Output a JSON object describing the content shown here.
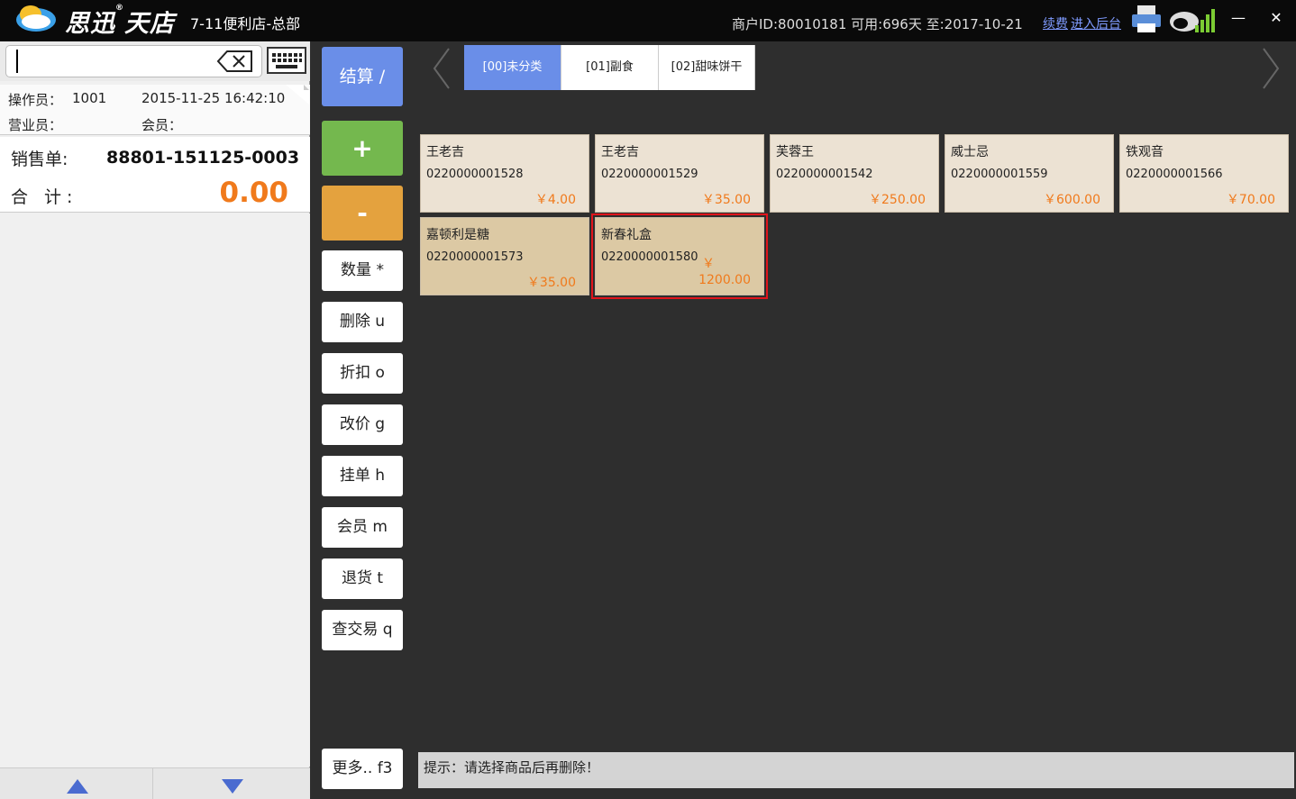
{
  "header": {
    "brand": "思迅",
    "brand_suffix": "天店",
    "registered": "®",
    "store_name": "7-11便利店-总部",
    "merchant_info": "商户ID:80010181 可用:696天 至:2017-10-21",
    "renew_link": "续费",
    "backend_link": "进入后台",
    "minimize": "—",
    "close": "✕"
  },
  "left": {
    "search": {
      "value": "",
      "placeholder": ""
    },
    "operator_label": "操作员：",
    "operator_value": "1001",
    "datetime": "2015-11-25 16:42:10",
    "clerk_label": "营业员：",
    "member_label": "会员：",
    "order_label": "销售单:",
    "order_no": "88801-151125-0003",
    "total_label": "合 计:",
    "total_value": "0.00"
  },
  "buttons": {
    "settle": "结算  /",
    "plus": "+",
    "minus": "-",
    "quantity": "数量 *",
    "delete": "删除 u",
    "discount": "折扣 o",
    "change_price": "改价 g",
    "hold": "挂单 h",
    "member": "会员 m",
    "refund": "退货 t",
    "query": "查交易 q",
    "more": "更多.. f3"
  },
  "tabs": [
    {
      "label": "[00]未分类",
      "active": true
    },
    {
      "label": "[01]副食",
      "active": false
    },
    {
      "label": "[02]甜味饼干",
      "active": false
    }
  ],
  "products": [
    {
      "name": "王老吉",
      "code": "0220000001528",
      "price": "￥4.00"
    },
    {
      "name": "王老吉",
      "code": "0220000001529",
      "price": "￥35.00"
    },
    {
      "name": "芙蓉王",
      "code": "0220000001542",
      "price": "￥250.00"
    },
    {
      "name": "威士忌",
      "code": "0220000001559",
      "price": "￥600.00"
    },
    {
      "name": "铁观音",
      "code": "0220000001566",
      "price": "￥70.00"
    },
    {
      "name": "嘉顿利是糖",
      "code": "0220000001573",
      "price": "￥35.00"
    },
    {
      "name": "新春礼盒",
      "code": "0220000001580",
      "price": "￥",
      "price2": "1200.00"
    }
  ],
  "hint": "提示：请选择商品后再删除！",
  "colors": {
    "accent_blue": "#6a8ee8",
    "plus_green": "#74b84e",
    "minus_orange": "#e4a23e",
    "price_orange": "#f07a1c",
    "highlight_red": "#e0141b"
  }
}
